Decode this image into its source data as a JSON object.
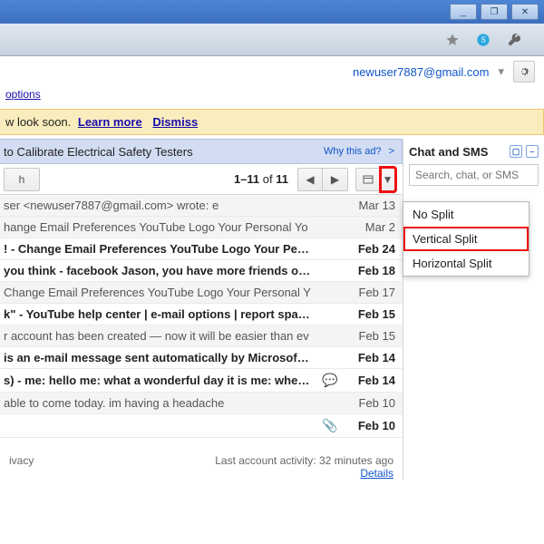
{
  "window_controls": {
    "min": "_",
    "max": "❐",
    "close": "✕"
  },
  "account": {
    "email": "newuser7887@gmail.com"
  },
  "options_link": "options",
  "notice": {
    "prefix": "w look soon.",
    "learn_more": "Learn more",
    "dismiss": "Dismiss"
  },
  "ad": {
    "text": "to Calibrate Electrical Safety Testers",
    "why": "Why this ad?",
    "right_arrow": ">"
  },
  "toolbar": {
    "left_fragment": "h",
    "count_prefix": "1–11",
    "count_of": "of",
    "count_total": "11",
    "prev_glyph": "◀",
    "next_glyph": "▶",
    "split_icon_glyph": "▭",
    "caret_glyph": "▼"
  },
  "split_menu": {
    "items": [
      "No Split",
      "Vertical Split",
      "Horizontal Split"
    ],
    "highlight_index": 1
  },
  "chat": {
    "title": "Chat and SMS",
    "search_placeholder": "Search, chat, or SMS"
  },
  "messages": [
    {
      "read": true,
      "text": "ser <newuser7887@gmail.com> wrote: e",
      "icon": "",
      "date": "Mar 13"
    },
    {
      "read": true,
      "text": "hange Email Preferences YouTube Logo Your Personal Yo",
      "icon": "",
      "date": "Mar 2"
    },
    {
      "read": false,
      "text": "! - Change Email Preferences YouTube Logo Your Persona",
      "icon": "",
      "date": "Feb 24"
    },
    {
      "read": false,
      "text": "you think - facebook Jason, you have more friends on Face",
      "icon": "",
      "date": "Feb 18"
    },
    {
      "read": true,
      "text": "Change Email Preferences YouTube Logo Your Personal Y",
      "icon": "",
      "date": "Feb 17"
    },
    {
      "read": false,
      "text": "k\" - YouTube help center | e-mail options | report spam Dea",
      "icon": "",
      "date": "Feb 15"
    },
    {
      "read": true,
      "text": "r account has been created — now it will be easier than ev",
      "icon": "",
      "date": "Feb 15"
    },
    {
      "read": false,
      "text": "is an e-mail message sent automatically by Microsoft Offic",
      "icon": "",
      "date": "Feb 14"
    },
    {
      "read": false,
      "text": "s) - me: hello me: what a wonderful day it is me: where hav",
      "icon": "chat",
      "date": "Feb 14"
    },
    {
      "read": true,
      "text": "able to come today. im having a headache",
      "icon": "",
      "date": "Feb 10"
    },
    {
      "read": false,
      "text": " ",
      "icon": "attach",
      "date": "Feb 10"
    }
  ],
  "footer": {
    "left": "ivacy",
    "activity": "Last account activity: 32 minutes ago",
    "details": "Details"
  }
}
